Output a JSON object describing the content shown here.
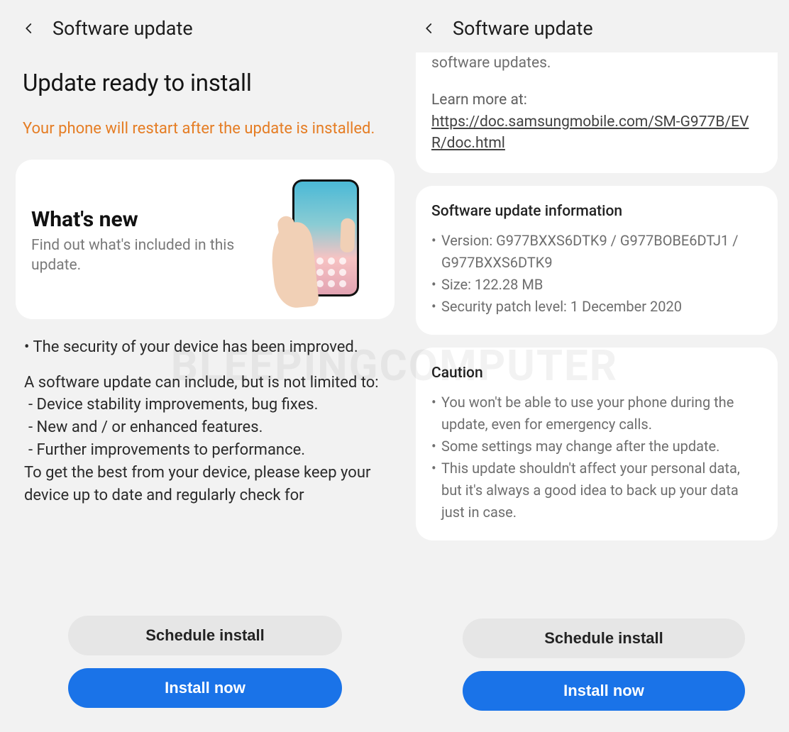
{
  "watermark": "BLEEPINGCOMPUTER",
  "header_title": "Software update",
  "buttons": {
    "schedule": "Schedule install",
    "install": "Install now"
  },
  "left": {
    "headline": "Update ready to install",
    "warning": "Your phone will restart after the update is installed.",
    "whats_new_title": "What's new",
    "whats_new_sub": "Find out what's included in this update.",
    "bullet_security": "• The security of your device has been improved.",
    "intro_line": "A software update can include, but is not limited to:",
    "li1": " - Device stability improvements, bug fixes.",
    "li2": " - New and / or enhanced features.",
    "li3": " - Further improvements to performance.",
    "tail": "To get the best from your device, please keep your device up to date and regularly check for"
  },
  "right": {
    "top_fragment": "software updates.",
    "learn_more_label": "Learn more at:",
    "learn_more_url": "https://doc.samsungmobile.com/SM-G977B/EVR/doc.html",
    "info_title": "Software update information",
    "info_version_label": "Version:",
    "info_version_value": "G977BXXS6DTK9 / G977BOBE6DTJ1 / G977BXXS6DTK9",
    "info_size_label": "Size:",
    "info_size_value": "122.28 MB",
    "info_patch_label": "Security patch level:",
    "info_patch_value": "1 December 2020",
    "caution_title": "Caution",
    "caution_items": [
      "You won't be able to use your phone during the update, even for emergency calls.",
      "Some settings may change after the update.",
      "This update shouldn't affect your personal data, but it's always a good idea to back up your data just in case."
    ]
  }
}
